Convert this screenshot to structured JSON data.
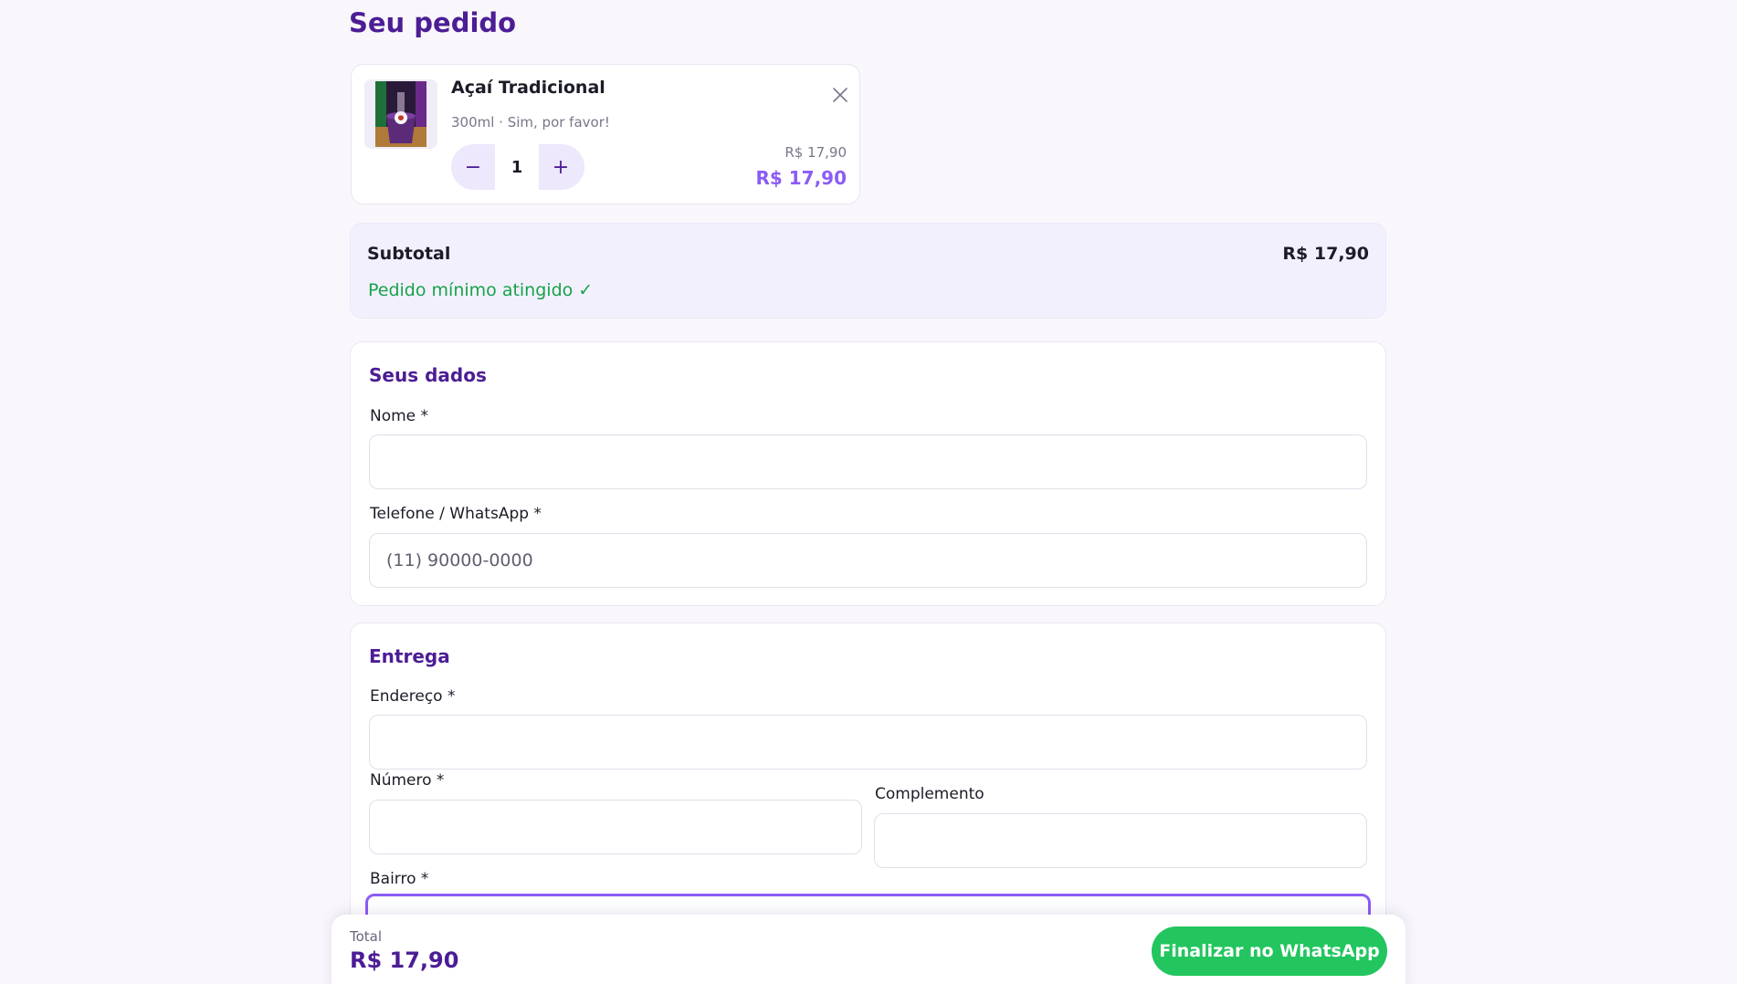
{
  "page": {
    "title": "Seu pedido"
  },
  "cart": {
    "items": [
      {
        "name": "Açaí Tradicional",
        "details": "300ml · Sim, por favor!",
        "quantity": "1",
        "decrement_label": "−",
        "increment_label": "+",
        "unit_price": "R$ 17,90",
        "line_total": "R$ 17,90"
      }
    ]
  },
  "summary": {
    "subtotal_label": "Subtotal",
    "subtotal_value": "R$ 17,90",
    "min_order_text": "Pedido mínimo atingido ✓"
  },
  "customer": {
    "title": "Seus dados",
    "name_label": "Nome *",
    "name_value": "",
    "name_placeholder": "",
    "phone_label": "Telefone / WhatsApp *",
    "phone_value": "",
    "phone_placeholder": "(11) 90000-0000"
  },
  "delivery": {
    "title": "Entrega",
    "address_label": "Endereço *",
    "address_value": "",
    "address_placeholder": "",
    "number_label": "Número *",
    "number_value": "",
    "number_placeholder": "",
    "complement_label": "Complemento",
    "complement_value": "",
    "complement_placeholder": "",
    "neighborhood_label": "Bairro *",
    "neighborhood_value": "",
    "neighborhood_placeholder": ""
  },
  "footer": {
    "total_label": "Total",
    "total_value": "R$ 17,90",
    "finish_button": "Finalizar no WhatsApp"
  },
  "colors": {
    "brand": "#4c1d95",
    "accent": "#8b5cf6",
    "success": "#16a34a",
    "whatsapp_button": "#22c55e"
  },
  "icons": {
    "remove": "close-icon",
    "product": "acai-cup-image"
  }
}
